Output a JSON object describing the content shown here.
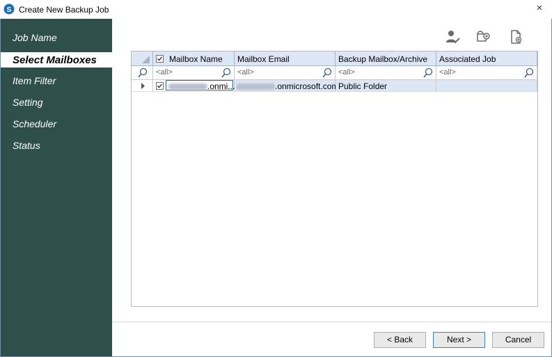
{
  "window": {
    "title": "Create New Backup Job",
    "close_glyph": "×"
  },
  "sidebar": {
    "items": [
      {
        "label": "Job Name",
        "active": false
      },
      {
        "label": "Select Mailboxes",
        "active": true
      },
      {
        "label": "Item Filter",
        "active": false
      },
      {
        "label": "Setting",
        "active": false
      },
      {
        "label": "Scheduler",
        "active": false
      },
      {
        "label": "Status",
        "active": false
      }
    ]
  },
  "toolbar": {
    "icons": [
      "user-check-icon",
      "mailbox-add-icon",
      "document-add-icon"
    ]
  },
  "grid": {
    "columns": [
      "Mailbox Name",
      "Mailbox Email",
      "Backup Mailbox/Archive",
      "Associated Job"
    ],
    "filter_placeholder": "<all>",
    "rows": [
      {
        "checked": true,
        "mailbox_name_suffix": ".onmi...",
        "mailbox_email_suffix": ".onmicrosoft.com",
        "backup_type": "Public Folder",
        "associated_job": ""
      }
    ]
  },
  "buttons": {
    "back": "< Back",
    "next": "Next >",
    "cancel": "Cancel"
  },
  "colors": {
    "sidebar_bg": "#2f4f4b",
    "header_bg": "#dce6f4",
    "accent": "#3c7fb1"
  }
}
